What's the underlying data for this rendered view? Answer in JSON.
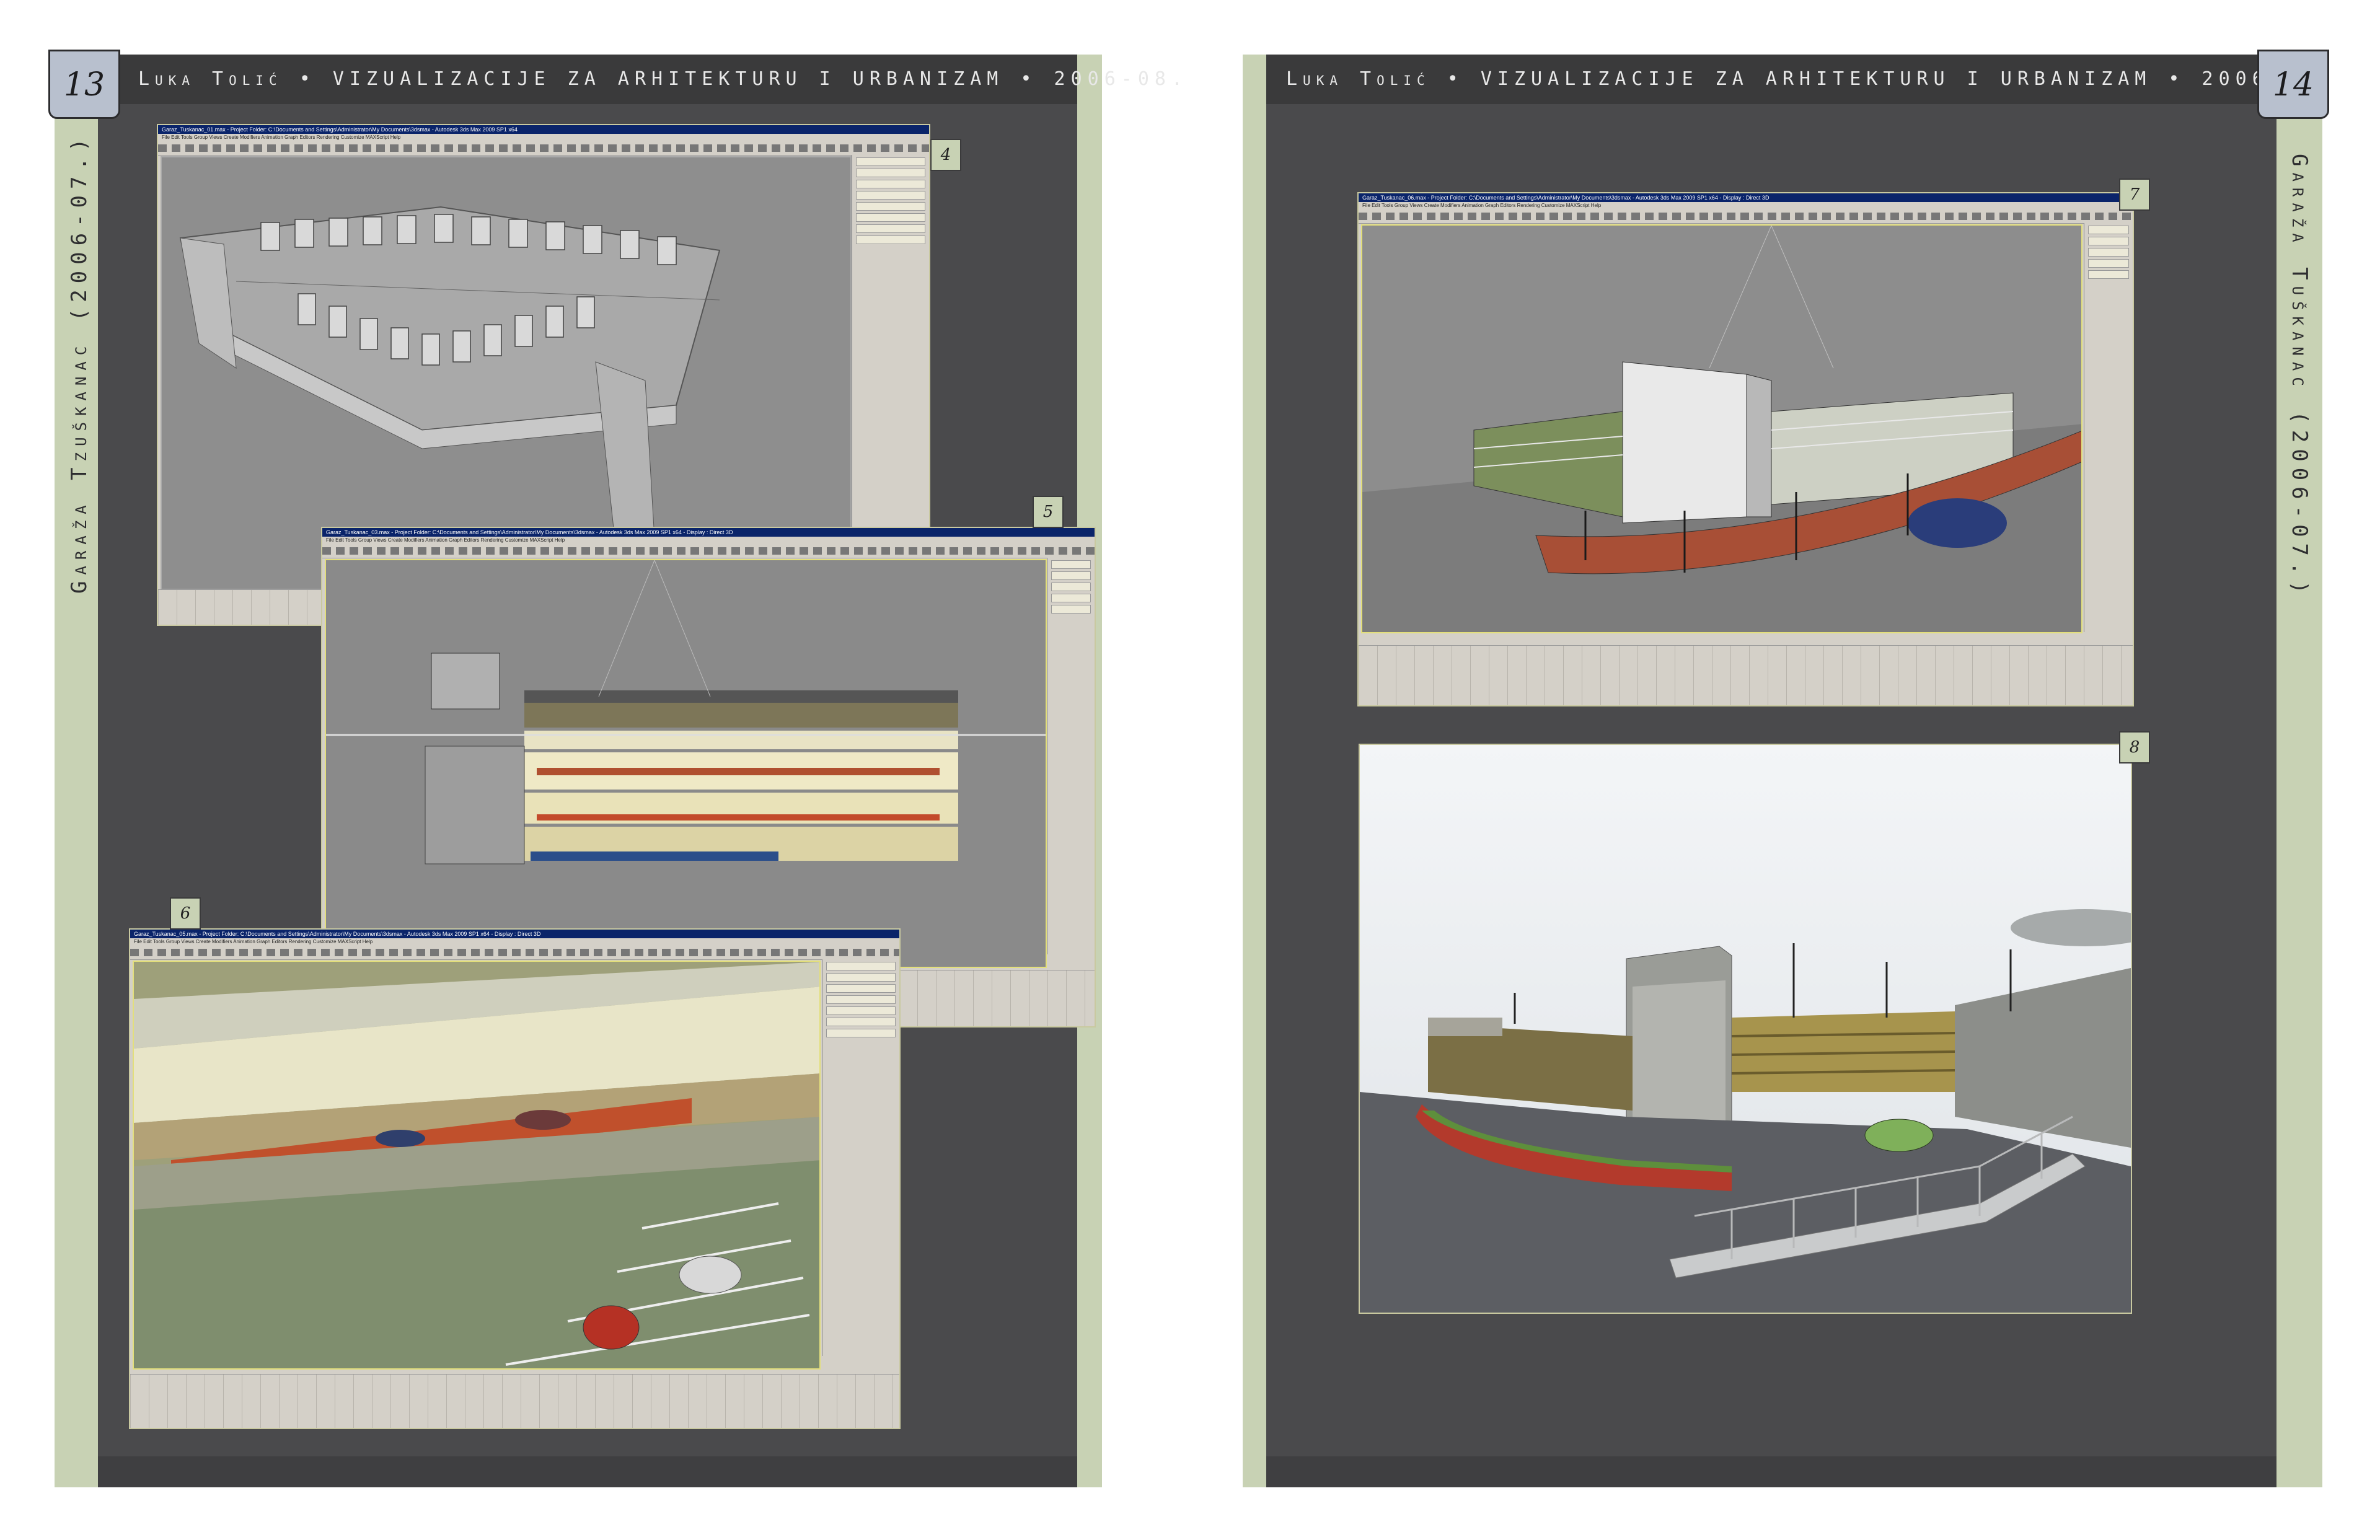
{
  "spread": {
    "header_author": "Luka Tolić",
    "header_rest": " • VIZUALIZACIJE ZA ARHITEKTURU I URBANIZAM • 2006-08."
  },
  "left_page": {
    "page_number": "13",
    "vertical_title": "Garaža Tzuškanac (2006-07.)",
    "figures": [
      {
        "number": "4",
        "window_title": "Garaz_Tuskanac_01.max - Project Folder: C:\\Documents and Settings\\Administrator\\My Documents\\3dsmax - Autodesk 3ds Max 2009 SP1 x64"
      },
      {
        "number": "5",
        "window_title": "Garaz_Tuskanac_03.max - Project Folder: C:\\Documents and Settings\\Administrator\\My Documents\\3dsmax - Autodesk 3ds Max 2009 SP1 x64 - Display : Direct 3D"
      },
      {
        "number": "6",
        "window_title": "Garaz_Tuskanac_05.max - Project Folder: C:\\Documents and Settings\\Administrator\\My Documents\\3dsmax - Autodesk 3ds Max 2009 SP1 x64 - Display : Direct 3D"
      }
    ]
  },
  "right_page": {
    "page_number": "14",
    "vertical_title": "Garaža Tuškanac (2006-07.)",
    "figures": [
      {
        "number": "7",
        "window_title": "Garaz_Tuskanac_06.max - Project Folder: C:\\Documents and Settings\\Administrator\\My Documents\\3dsmax - Autodesk 3ds Max 2009 SP1 x64 - Display : Direct 3D"
      },
      {
        "number": "8"
      }
    ]
  },
  "app_menu": "File  Edit  Tools  Group  Views  Create  Modifiers  Animation  Graph Editors  Rendering  Customize  MAXScript  Help",
  "colors": {
    "panel": "#4a4a4c",
    "strip": "#c8d2b4",
    "header": "#3a3a3b",
    "page_number_box": "#b8c0ce"
  }
}
